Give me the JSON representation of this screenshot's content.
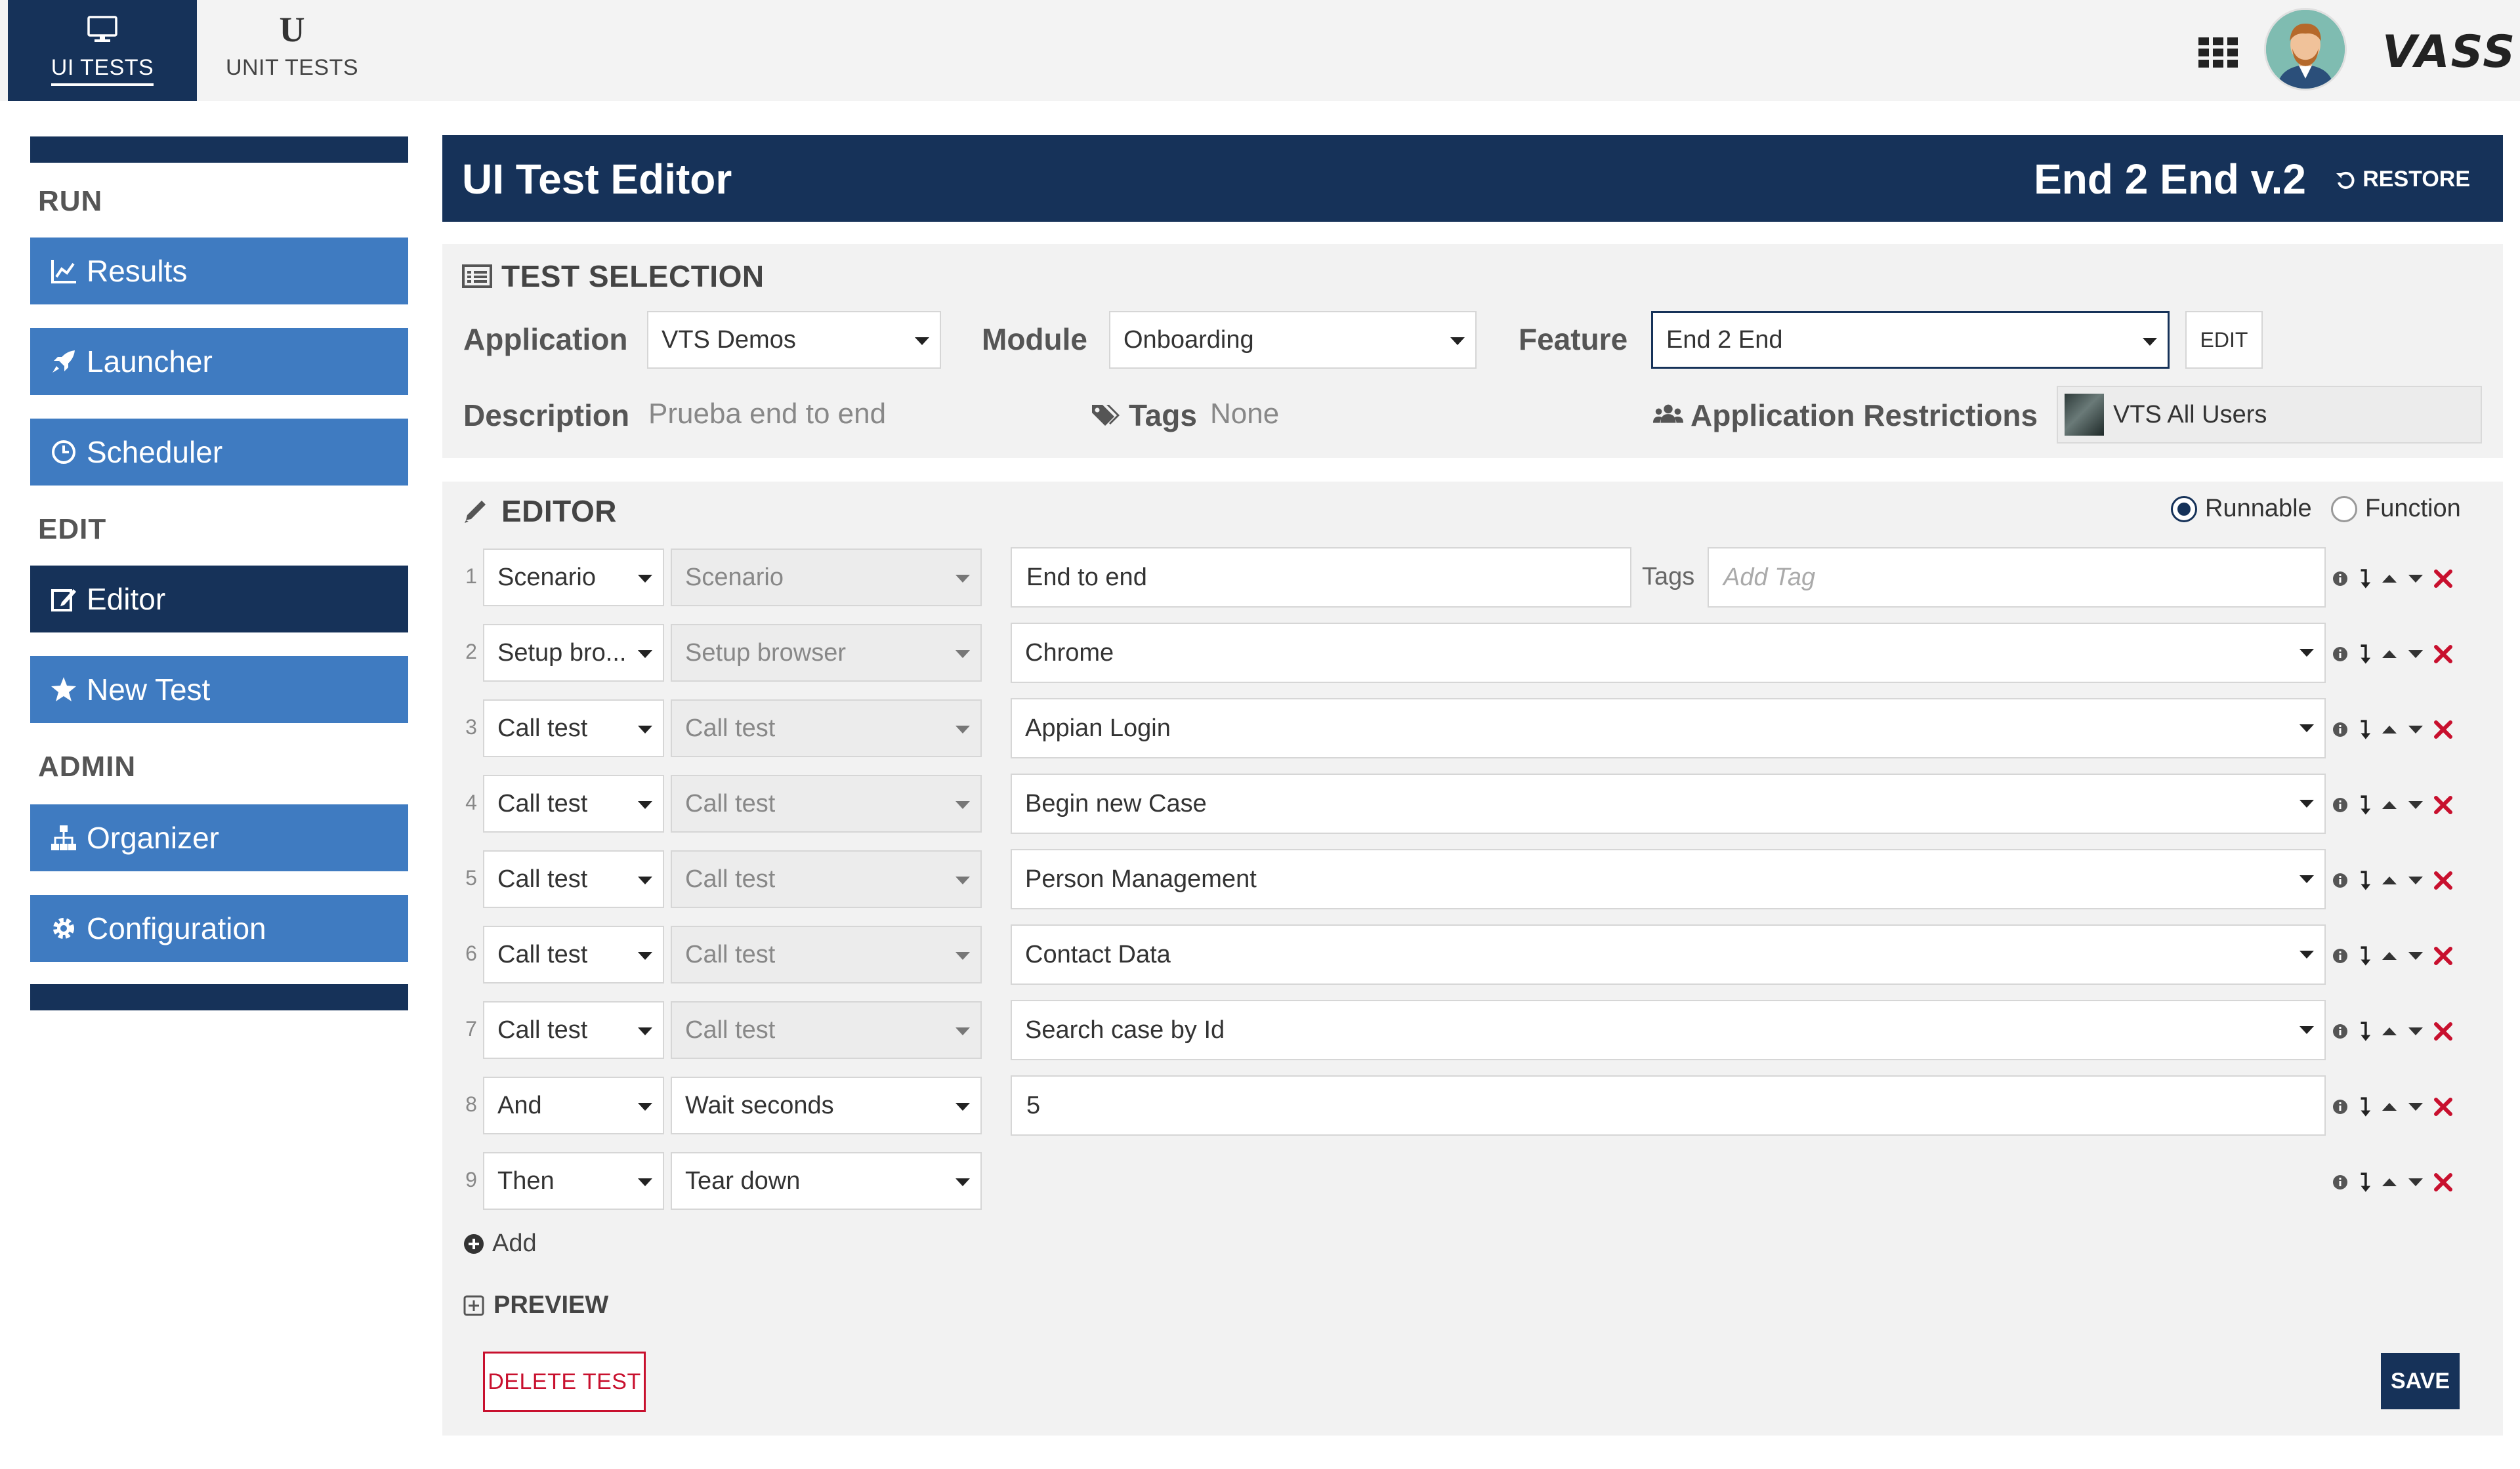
{
  "topbar": {
    "tabs": [
      {
        "label": "UI TESTS",
        "icon": "monitor-icon",
        "active": true
      },
      {
        "label": "UNIT TESTS",
        "icon": "u-icon",
        "active": false
      }
    ],
    "u_glyph": "U",
    "brand": "VASS"
  },
  "sidebar": {
    "sections": [
      {
        "title": "RUN",
        "items": [
          {
            "label": "Results",
            "icon": "chart-icon"
          },
          {
            "label": "Launcher",
            "icon": "rocket-icon"
          },
          {
            "label": "Scheduler",
            "icon": "clock-icon"
          }
        ]
      },
      {
        "title": "EDIT",
        "items": [
          {
            "label": "Editor",
            "icon": "edit-icon",
            "active": true
          },
          {
            "label": "New Test",
            "icon": "star-icon"
          }
        ]
      },
      {
        "title": "ADMIN",
        "items": [
          {
            "label": "Organizer",
            "icon": "sitemap-icon"
          },
          {
            "label": "Configuration",
            "icon": "gear-icon"
          }
        ]
      }
    ]
  },
  "header": {
    "title": "UI Test Editor",
    "version": "End 2 End v.2",
    "restore_label": "RESTORE"
  },
  "selection": {
    "title": "TEST SELECTION",
    "application_label": "Application",
    "application_value": "VTS Demos",
    "module_label": "Module",
    "module_value": "Onboarding",
    "feature_label": "Feature",
    "feature_value": "End 2 End",
    "edit_label": "EDIT",
    "description_label": "Description",
    "description_value": "Prueba end to end",
    "tags_label": "Tags",
    "tags_value": "None",
    "restrictions_label": "Application Restrictions",
    "restrictions_value": "VTS All Users"
  },
  "editor": {
    "title": "EDITOR",
    "mode_options": [
      "Runnable",
      "Function"
    ],
    "mode_selected": "Runnable",
    "tags_label": "Tags",
    "tags_placeholder": "Add Tag",
    "rows": [
      {
        "num": "1",
        "keyword": "Scenario",
        "step": "Scenario",
        "step_disabled": true,
        "value": "End to end",
        "value_type": "text"
      },
      {
        "num": "2",
        "keyword": "Setup bro...",
        "step": "Setup browser",
        "step_disabled": true,
        "value": "Chrome",
        "value_type": "select"
      },
      {
        "num": "3",
        "keyword": "Call test",
        "step": "Call test",
        "step_disabled": true,
        "value": "Appian Login",
        "value_type": "select"
      },
      {
        "num": "4",
        "keyword": "Call test",
        "step": "Call test",
        "step_disabled": true,
        "value": "Begin new Case",
        "value_type": "select"
      },
      {
        "num": "5",
        "keyword": "Call test",
        "step": "Call test",
        "step_disabled": true,
        "value": "Person Management",
        "value_type": "select"
      },
      {
        "num": "6",
        "keyword": "Call test",
        "step": "Call test",
        "step_disabled": true,
        "value": "Contact Data",
        "value_type": "select"
      },
      {
        "num": "7",
        "keyword": "Call test",
        "step": "Call test",
        "step_disabled": true,
        "value": "Search case by Id",
        "value_type": "select"
      },
      {
        "num": "8",
        "keyword": "And",
        "step": "Wait seconds",
        "step_disabled": false,
        "value": "5",
        "value_type": "text"
      },
      {
        "num": "9",
        "keyword": "Then",
        "step": "Tear down",
        "step_disabled": false,
        "value": "",
        "value_type": "none"
      }
    ],
    "add_label": "Add",
    "preview_label": "PREVIEW",
    "delete_label": "DELETE TEST",
    "save_label": "SAVE"
  },
  "colors": {
    "navy": "#163259",
    "blue": "#3f7bc1",
    "danger": "#c8102e"
  }
}
